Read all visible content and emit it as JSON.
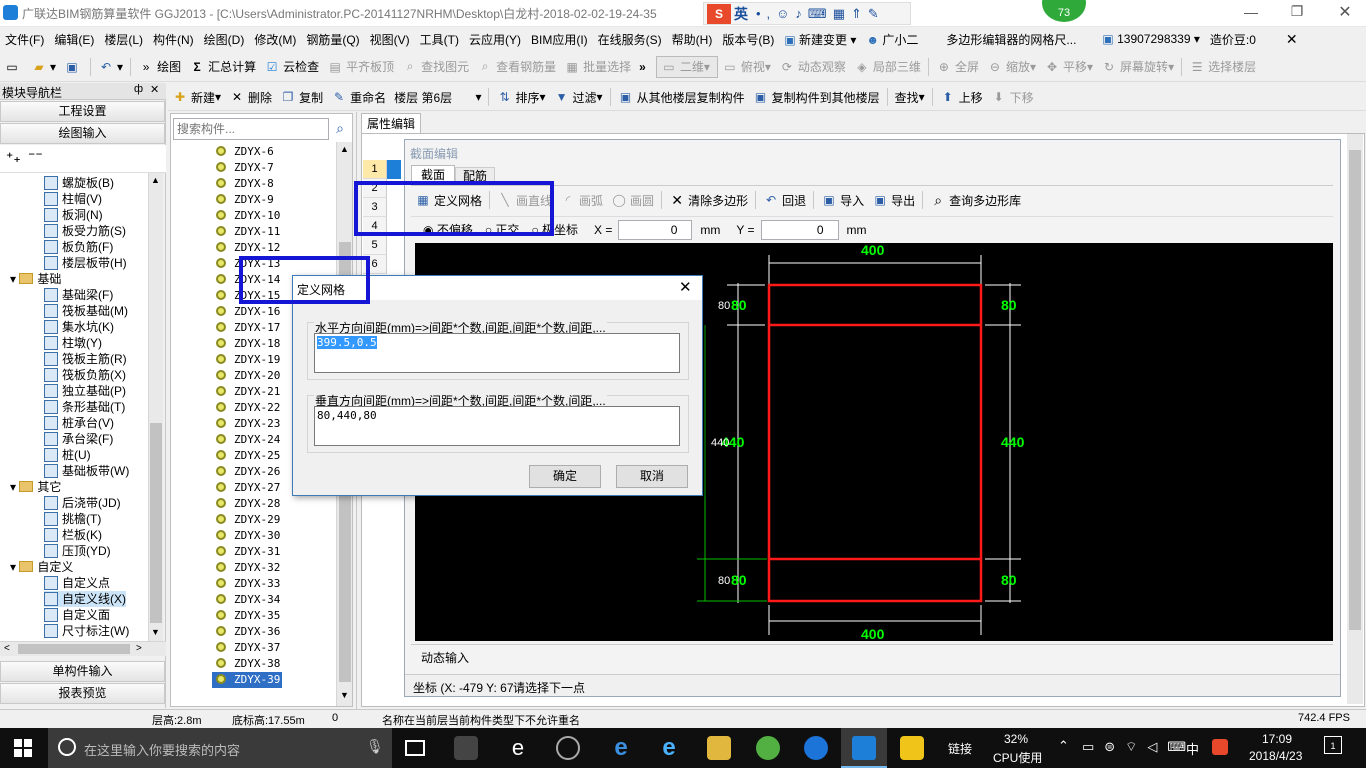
{
  "window": {
    "title": "广联达BIM钢筋算量软件 GGJ2013 - [C:\\Users\\Administrator.PC-20141127NRHM\\Desktop\\白龙村-2018-02-02-19-24-35",
    "badge": "73",
    "ime": "英"
  },
  "menu": [
    "文件(F)",
    "编辑(E)",
    "楼层(L)",
    "构件(N)",
    "绘图(D)",
    "修改(M)",
    "钢筋量(Q)",
    "视图(V)",
    "工具(T)",
    "云应用(Y)",
    "BIM应用(I)",
    "在线服务(S)",
    "帮助(H)",
    "版本号(B)",
    "新建变更",
    "广小二",
    "多边形编辑器的网格尺...",
    "13907298339",
    "造价豆:0"
  ],
  "toolbar1": {
    "draw": "绘图",
    "sum": "汇总计算",
    "cloud_check": "云检查",
    "flat_top": "平齐板顶",
    "find_elem": "查找图元",
    "view_rebar": "查看钢筋量",
    "batch_select": "批量选择",
    "view_mode": "二维",
    "top_view": "俯视",
    "dynamic": "动态观察",
    "local3d": "局部三维",
    "fullscreen": "全屏",
    "zoom": "缩放",
    "pan": "平移",
    "rotate": "屏幕旋转",
    "select_floor": "选择楼层"
  },
  "toolbar2": {
    "new": "新建",
    "delete": "删除",
    "copy": "复制",
    "rename": "重命名",
    "floor_label": "楼层",
    "floor_value": "第6层",
    "sort": "排序",
    "filter": "过滤",
    "copy_from": "从其他楼层复制构件",
    "copy_to": "复制构件到其他楼层",
    "find": "查找",
    "up": "上移",
    "down": "下移"
  },
  "nav": {
    "title": "模块导航栏",
    "pin": "ф",
    "project_settings": "工程设置",
    "draw_input": "绘图输入",
    "single_input": "单构件输入",
    "report": "报表预览"
  },
  "tree": [
    {
      "label": "螺旋板(B)",
      "level": 2
    },
    {
      "label": "柱帽(V)",
      "level": 2
    },
    {
      "label": "板洞(N)",
      "level": 2
    },
    {
      "label": "板受力筋(S)",
      "level": 2
    },
    {
      "label": "板负筋(F)",
      "level": 2
    },
    {
      "label": "楼层板带(H)",
      "level": 2
    },
    {
      "label": "基础",
      "level": 1
    },
    {
      "label": "基础梁(F)",
      "level": 2
    },
    {
      "label": "筏板基础(M)",
      "level": 2
    },
    {
      "label": "集水坑(K)",
      "level": 2
    },
    {
      "label": "柱墩(Y)",
      "level": 2
    },
    {
      "label": "筏板主筋(R)",
      "level": 2
    },
    {
      "label": "筏板负筋(X)",
      "level": 2
    },
    {
      "label": "独立基础(P)",
      "level": 2
    },
    {
      "label": "条形基础(T)",
      "level": 2
    },
    {
      "label": "桩承台(V)",
      "level": 2
    },
    {
      "label": "承台梁(F)",
      "level": 2
    },
    {
      "label": "桩(U)",
      "level": 2
    },
    {
      "label": "基础板带(W)",
      "level": 2
    },
    {
      "label": "其它",
      "level": 1
    },
    {
      "label": "后浇带(JD)",
      "level": 2
    },
    {
      "label": "挑檐(T)",
      "level": 2
    },
    {
      "label": "栏板(K)",
      "level": 2
    },
    {
      "label": "压顶(YD)",
      "level": 2
    },
    {
      "label": "自定义",
      "level": 1
    },
    {
      "label": "自定义点",
      "level": 2
    },
    {
      "label": "自定义线(X)",
      "level": 2
    },
    {
      "label": "自定义面",
      "level": 2
    },
    {
      "label": "尺寸标注(W)",
      "level": 2
    }
  ],
  "search": {
    "placeholder": "搜索构件..."
  },
  "components": [
    "ZDYX-6",
    "ZDYX-7",
    "ZDYX-8",
    "ZDYX-9",
    "ZDYX-10",
    "ZDYX-11",
    "ZDYX-12",
    "ZDYX-13",
    "ZDYX-14",
    "ZDYX-15",
    "ZDYX-16",
    "ZDYX-17",
    "ZDYX-18",
    "ZDYX-19",
    "ZDYX-20",
    "ZDYX-21",
    "ZDYX-22",
    "ZDYX-23",
    "ZDYX-24",
    "ZDYX-25",
    "ZDYX-26",
    "ZDYX-27",
    "ZDYX-28",
    "ZDYX-29",
    "ZDYX-30",
    "ZDYX-31",
    "ZDYX-32",
    "ZDYX-33",
    "ZDYX-34",
    "ZDYX-35",
    "ZDYX-36",
    "ZDYX-37",
    "ZDYX-38",
    "ZDYX-39"
  ],
  "selected_component": "ZDYX-39",
  "prop_tab": "属性编辑",
  "rows": [
    "1",
    "2",
    "3",
    "4",
    "5",
    "6"
  ],
  "section": {
    "title": "截面编辑",
    "tab_section": "截面",
    "tab_rebar": "配筋",
    "define_grid": "定义网格",
    "line": "画直线",
    "arc": "画弧",
    "circle": "画圆",
    "clear": "清除多边形",
    "undo": "回退",
    "import": "导入",
    "export": "导出",
    "query": "查询多边形库",
    "no_offset": "不偏移",
    "ortho": "正交",
    "polar": "极坐标",
    "x_label": "X =",
    "x_value": "0",
    "x_unit": "mm",
    "y_label": "Y =",
    "y_value": "0",
    "y_unit": "mm",
    "dyn_input": "动态输入",
    "coord": "坐标 (X: -479 Y: 67",
    "coord_hint": "请选择下一点"
  },
  "drawing": {
    "top_dim": "400",
    "bottom_dim": "400",
    "left_top": "80",
    "left_mid": "440",
    "left_bot": "80",
    "right_top": "80",
    "right_mid": "440",
    "right_bot": "80",
    "small_top": "80",
    "small_mid": "440",
    "small_bot": "80"
  },
  "dialog": {
    "title": "定义网格",
    "h_label": "水平方向间距(mm)=>间距*个数,间距,间距*个数,间距,...",
    "h_value": "399.5,0.5",
    "v_label": "垂直方向间距(mm)=>间距*个数,间距,间距*个数,间距,...",
    "v_value": "80,440,80",
    "ok": "确定",
    "cancel": "取消"
  },
  "status": {
    "floor_height": "层高:2.8m",
    "bottom_height": "底标高:17.55m",
    "zero": "0",
    "message": "名称在当前层当前构件类型下不允许重名",
    "fps": "742.4 FPS"
  },
  "taskbar": {
    "search": "在这里输入你要搜索的内容",
    "link": "链接",
    "cpu": "32%",
    "cpu_label": "CPU使用",
    "lang": "中",
    "time": "17:09",
    "date": "2018/4/23",
    "notif": "1"
  },
  "colors": {
    "canvas": "#000000",
    "polygon": "#ff0000",
    "dim": "#00ff00",
    "annotation": "#1515d6"
  }
}
